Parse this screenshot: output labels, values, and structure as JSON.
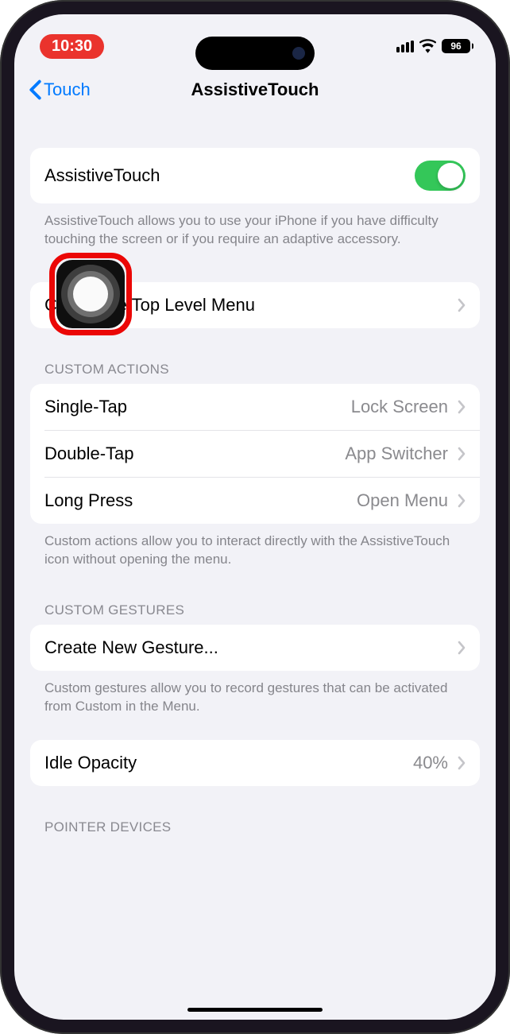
{
  "status": {
    "time": "10:30",
    "battery": "96"
  },
  "nav": {
    "back_label": "Touch",
    "title": "AssistiveTouch"
  },
  "main_toggle": {
    "label": "AssistiveTouch",
    "enabled": true,
    "description": "AssistiveTouch allows you to use your iPhone if you have difficulty touching the screen or if you require an adaptive accessory."
  },
  "customize": {
    "label": "Customize Top Level Menu"
  },
  "custom_actions": {
    "header": "CUSTOM ACTIONS",
    "items": [
      {
        "label": "Single-Tap",
        "value": "Lock Screen"
      },
      {
        "label": "Double-Tap",
        "value": "App Switcher"
      },
      {
        "label": "Long Press",
        "value": "Open Menu"
      }
    ],
    "footer": "Custom actions allow you to interact directly with the AssistiveTouch icon without opening the menu."
  },
  "custom_gestures": {
    "header": "CUSTOM GESTURES",
    "create_label": "Create New Gesture...",
    "footer": "Custom gestures allow you to record gestures that can be activated from Custom in the Menu."
  },
  "idle_opacity": {
    "label": "Idle Opacity",
    "value": "40%"
  },
  "pointer_devices": {
    "header": "POINTER DEVICES"
  }
}
